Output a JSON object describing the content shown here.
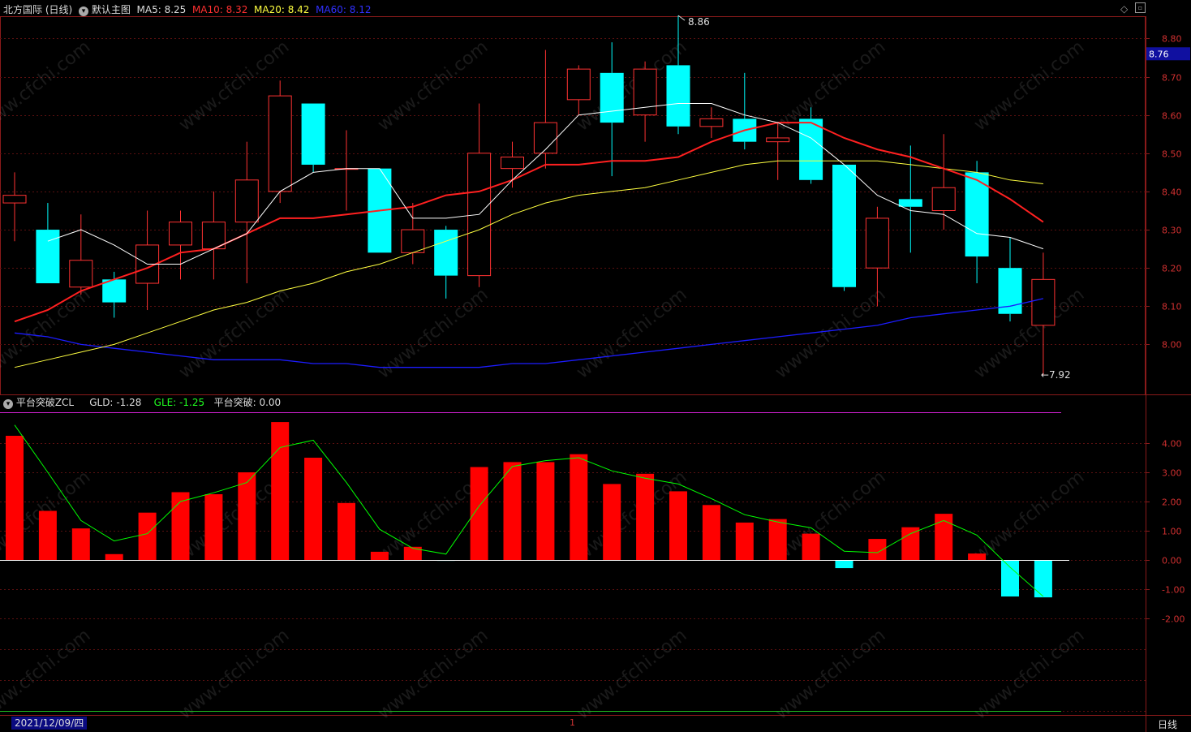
{
  "header": {
    "stock": "北方国际 (日线)",
    "template": "默认主图",
    "ma5_label": "MA5:",
    "ma5_value": "8.25",
    "ma10_label": "MA10:",
    "ma10_value": "8.32",
    "ma20_label": "MA20:",
    "ma20_value": "8.42",
    "ma60_label": "MA60:",
    "ma60_value": "8.12"
  },
  "sub_header": {
    "indicator": "平台突破ZCL",
    "gld_label": "GLD:",
    "gld_value": "-1.28",
    "gle_label": "GLE:",
    "gle_value": "-1.25",
    "pt_label": "平台突破:",
    "pt_value": "0.00"
  },
  "footer": {
    "date": "2021/12/09/四",
    "period": "日线",
    "marker": "1"
  },
  "watermark": "www.cfchi.com",
  "colors": {
    "up": "#ff3232",
    "down": "#00ffff",
    "ma5": "#ffffff",
    "ma10": "#ff2020",
    "ma20": "#ffff40",
    "ma60": "#1c1cff",
    "gle": "#00ff00",
    "price_tag": "#1010a0"
  },
  "chart_data": [
    {
      "type": "candlestick",
      "y_ticks": [
        8.8,
        8.7,
        8.6,
        8.5,
        8.4,
        8.3,
        8.2,
        8.1,
        8.0
      ],
      "ylim": [
        7.88,
        8.82
      ],
      "current_price": "8.76",
      "annotations": [
        {
          "index": 20,
          "label": "8.86",
          "kind": "high"
        },
        {
          "index": 31,
          "label": "7.92",
          "kind": "low"
        }
      ],
      "candles": [
        {
          "o": 8.37,
          "h": 8.45,
          "l": 8.27,
          "c": 8.39
        },
        {
          "o": 8.3,
          "h": 8.37,
          "l": 8.16,
          "c": 8.16
        },
        {
          "o": 8.15,
          "h": 8.34,
          "l": 8.13,
          "c": 8.22
        },
        {
          "o": 8.17,
          "h": 8.19,
          "l": 8.07,
          "c": 8.11
        },
        {
          "o": 8.16,
          "h": 8.35,
          "l": 8.09,
          "c": 8.26
        },
        {
          "o": 8.26,
          "h": 8.35,
          "l": 8.17,
          "c": 8.32
        },
        {
          "o": 8.25,
          "h": 8.4,
          "l": 8.17,
          "c": 8.32
        },
        {
          "o": 8.32,
          "h": 8.53,
          "l": 8.16,
          "c": 8.43
        },
        {
          "o": 8.4,
          "h": 8.69,
          "l": 8.37,
          "c": 8.65
        },
        {
          "o": 8.63,
          "h": 8.63,
          "l": 8.45,
          "c": 8.47
        },
        {
          "o": 8.46,
          "h": 8.56,
          "l": 8.35,
          "c": 8.46
        },
        {
          "o": 8.46,
          "h": 8.46,
          "l": 8.24,
          "c": 8.24
        },
        {
          "o": 8.24,
          "h": 8.37,
          "l": 8.21,
          "c": 8.3
        },
        {
          "o": 8.3,
          "h": 8.31,
          "l": 8.12,
          "c": 8.18
        },
        {
          "o": 8.18,
          "h": 8.63,
          "l": 8.15,
          "c": 8.5
        },
        {
          "o": 8.46,
          "h": 8.53,
          "l": 8.41,
          "c": 8.49
        },
        {
          "o": 8.5,
          "h": 8.77,
          "l": 8.46,
          "c": 8.58
        },
        {
          "o": 8.64,
          "h": 8.73,
          "l": 8.6,
          "c": 8.72
        },
        {
          "o": 8.71,
          "h": 8.79,
          "l": 8.44,
          "c": 8.58
        },
        {
          "o": 8.6,
          "h": 8.74,
          "l": 8.53,
          "c": 8.72
        },
        {
          "o": 8.73,
          "h": 8.86,
          "l": 8.55,
          "c": 8.57
        },
        {
          "o": 8.57,
          "h": 8.62,
          "l": 8.54,
          "c": 8.59
        },
        {
          "o": 8.59,
          "h": 8.71,
          "l": 8.51,
          "c": 8.53
        },
        {
          "o": 8.53,
          "h": 8.58,
          "l": 8.43,
          "c": 8.54
        },
        {
          "o": 8.59,
          "h": 8.62,
          "l": 8.42,
          "c": 8.43
        },
        {
          "o": 8.47,
          "h": 8.47,
          "l": 8.14,
          "c": 8.15
        },
        {
          "o": 8.2,
          "h": 8.36,
          "l": 8.1,
          "c": 8.33
        },
        {
          "o": 8.38,
          "h": 8.52,
          "l": 8.24,
          "c": 8.36
        },
        {
          "o": 8.35,
          "h": 8.55,
          "l": 8.3,
          "c": 8.41
        },
        {
          "o": 8.45,
          "h": 8.48,
          "l": 8.16,
          "c": 8.23
        },
        {
          "o": 8.2,
          "h": 8.28,
          "l": 8.06,
          "c": 8.08
        },
        {
          "o": 8.05,
          "h": 8.24,
          "l": 7.92,
          "c": 8.17
        }
      ],
      "ma5": [
        null,
        8.27,
        8.3,
        8.26,
        8.21,
        8.21,
        8.25,
        8.29,
        8.4,
        8.45,
        8.46,
        8.46,
        8.33,
        8.33,
        8.34,
        8.43,
        8.51,
        8.6,
        8.61,
        8.62,
        8.63,
        8.63,
        8.6,
        8.58,
        8.54,
        8.47,
        8.39,
        8.35,
        8.34,
        8.29,
        8.28,
        8.25
      ],
      "ma10": [
        8.06,
        8.09,
        8.14,
        8.17,
        8.2,
        8.24,
        8.25,
        8.29,
        8.33,
        8.33,
        8.34,
        8.35,
        8.36,
        8.39,
        8.4,
        8.43,
        8.47,
        8.47,
        8.48,
        8.48,
        8.49,
        8.53,
        8.56,
        8.58,
        8.58,
        8.54,
        8.51,
        8.49,
        8.46,
        8.43,
        8.38,
        8.32
      ],
      "ma20": [
        7.94,
        7.96,
        7.98,
        8.0,
        8.03,
        8.06,
        8.09,
        8.11,
        8.14,
        8.16,
        8.19,
        8.21,
        8.24,
        8.27,
        8.3,
        8.34,
        8.37,
        8.39,
        8.4,
        8.41,
        8.43,
        8.45,
        8.47,
        8.48,
        8.48,
        8.48,
        8.48,
        8.47,
        8.46,
        8.45,
        8.43,
        8.42
      ],
      "ma60": [
        8.03,
        8.02,
        8.0,
        7.99,
        7.98,
        7.97,
        7.96,
        7.96,
        7.96,
        7.95,
        7.95,
        7.94,
        7.94,
        7.94,
        7.94,
        7.95,
        7.95,
        7.96,
        7.97,
        7.98,
        7.99,
        8.0,
        8.01,
        8.02,
        8.03,
        8.04,
        8.05,
        8.07,
        8.08,
        8.09,
        8.1,
        8.12
      ]
    },
    {
      "type": "bar",
      "name": "平台突破ZCL",
      "y_ticks": [
        4.0,
        3.0,
        2.0,
        1.0,
        0.0,
        -1.0,
        -2.0
      ],
      "ylim": [
        -2.0,
        5.0
      ],
      "gld": [
        4.25,
        1.68,
        1.08,
        0.2,
        1.62,
        2.32,
        2.25,
        3.0,
        4.72,
        3.5,
        1.95,
        0.28,
        0.45,
        -0.03,
        3.18,
        3.35,
        3.35,
        3.62,
        2.6,
        2.95,
        2.35,
        1.88,
        1.28,
        1.4,
        0.9,
        -0.28,
        0.72,
        1.12,
        1.58,
        0.22,
        -1.25,
        -1.28
      ],
      "gle": [
        4.62,
        3.0,
        1.35,
        0.65,
        0.9,
        2.0,
        2.3,
        2.65,
        3.85,
        4.1,
        2.65,
        1.05,
        0.4,
        0.2,
        1.85,
        3.2,
        3.4,
        3.5,
        3.05,
        2.8,
        2.6,
        2.1,
        1.55,
        1.3,
        1.1,
        0.3,
        0.25,
        0.9,
        1.35,
        0.85,
        -0.25,
        -1.25
      ],
      "zero_line": 0.0
    }
  ]
}
